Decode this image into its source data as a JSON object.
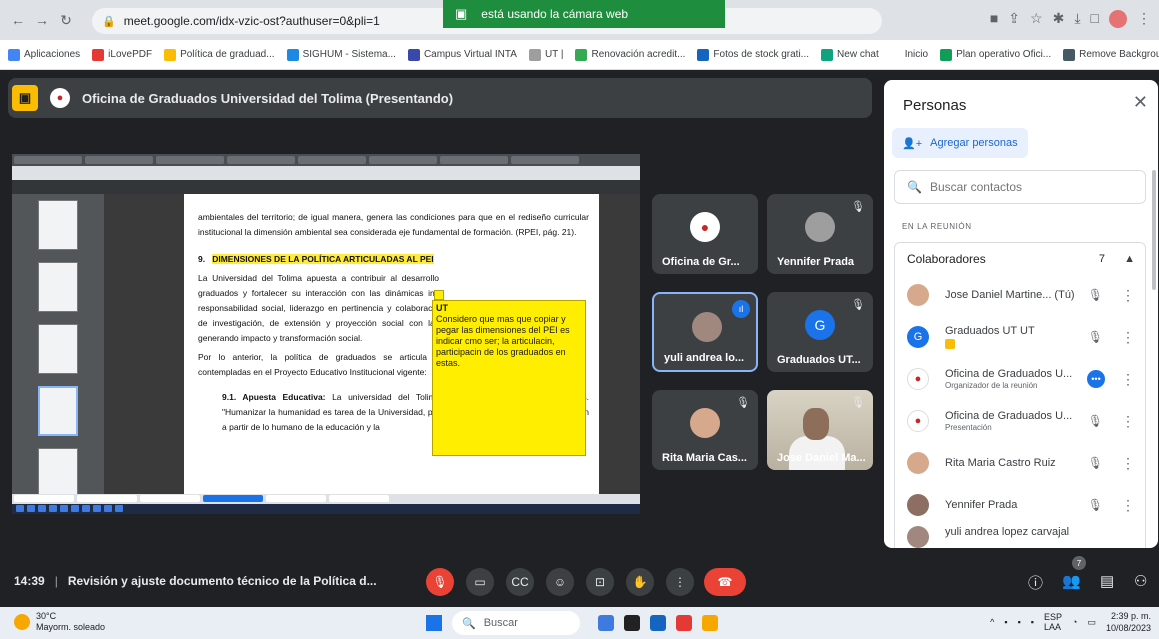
{
  "browser": {
    "url": "meet.google.com/idx-vzic-ost?authuser=0&pli=1",
    "camera_banner": "está usando la cámara web",
    "bookmarks": [
      "Aplicaciones",
      "iLovePDF",
      "Política de graduad...",
      "SIGHUM - Sistema...",
      "Campus Virtual INTA",
      "UT |",
      "Renovación acredit...",
      "Fotos de stock grati...",
      "New chat",
      "Inicio",
      "Plan operativo Ofici...",
      "Remove Backgroun..."
    ]
  },
  "presentation": {
    "title": "Oficina de Graduados Universidad del Tolima (Presentando)"
  },
  "document": {
    "p1": "ambientales del territorio; de igual manera, genera las condiciones para que en el rediseño curricular institucional la dimensión ambiental sea considerada eje fundamental de formación. (RPEI, pág. 21).",
    "heading_num": "9.",
    "heading": "DIMENSIONES DE LA POLÍTICA ARTICULADAS AL PEI",
    "p2": "La Universidad del Tolima apuesta a contribuir al desarrollo graduados y fortalecer su interacción con las dinámicas ins responsabilidad social, liderazgo en pertinencia y colaboració de investigación, de extensión y proyección social con las generando impacto y transformación social.",
    "p3": "Por lo anterior, la política de graduados se articula a contempladas en el Proyecto Educativo Institucional vigente:",
    "sub_title": "9.1. Apuesta Educativa:",
    "sub_text": "La universidad del Tolima le apue estudiantes y graduados. \"Humanizar la humanidad es tarea de la Universidad, por ello, es importante retomar la reflexión a partir de lo humano de la educación y la"
  },
  "sticky_note": {
    "author": "UT",
    "text": "Considero que mas que copiar y pegar las dimensiones del PEI es indicar cmo ser; la articulacin, participacin de los graduados en estas."
  },
  "tiles": [
    {
      "name": "Oficina de Gr...",
      "type": "logo"
    },
    {
      "name": "Yennifer Prada",
      "type": "photo"
    },
    {
      "name": "yuli andrea lo...",
      "type": "photo"
    },
    {
      "name": "Graduados UT...",
      "type": "letter",
      "letter": "G"
    },
    {
      "name": "Rita Maria Cas...",
      "type": "photo"
    },
    {
      "name": "Jose Daniel Ma...",
      "type": "video"
    }
  ],
  "people_panel": {
    "title": "Personas",
    "add_label": "Agregar personas",
    "search_placeholder": "Buscar contactos",
    "in_meeting_label": "EN LA REUNIÓN",
    "group_label": "Colaboradores",
    "group_count": "7",
    "people": [
      {
        "name": "Jose Daniel Martine... (Tú)",
        "sub": ""
      },
      {
        "name": "Graduados UT UT",
        "sub": ""
      },
      {
        "name": "Oficina de Graduados U...",
        "sub": "Organizador de la reunión"
      },
      {
        "name": "Oficina de Graduados U...",
        "sub": "Presentación"
      },
      {
        "name": "Rita Maria Castro Ruiz",
        "sub": ""
      },
      {
        "name": "Yennifer Prada",
        "sub": ""
      },
      {
        "name": "yuli andrea lopez carvajal",
        "sub": ""
      }
    ]
  },
  "controls": {
    "time": "14:39",
    "meeting_title": "Revisión y ajuste documento técnico de la Política d...",
    "participant_badge": "7"
  },
  "taskbar": {
    "temp": "30°C",
    "weather": "Mayorm. soleado",
    "search": "Buscar",
    "lang1": "ESP",
    "lang2": "LAA",
    "time": "2:39 p. m.",
    "date": "10/08/2023"
  },
  "colors": {
    "meet_bg": "#202124",
    "accent_blue": "#1a73e8",
    "end_call_red": "#ea4335",
    "sticky_yellow": "#ffee00"
  }
}
